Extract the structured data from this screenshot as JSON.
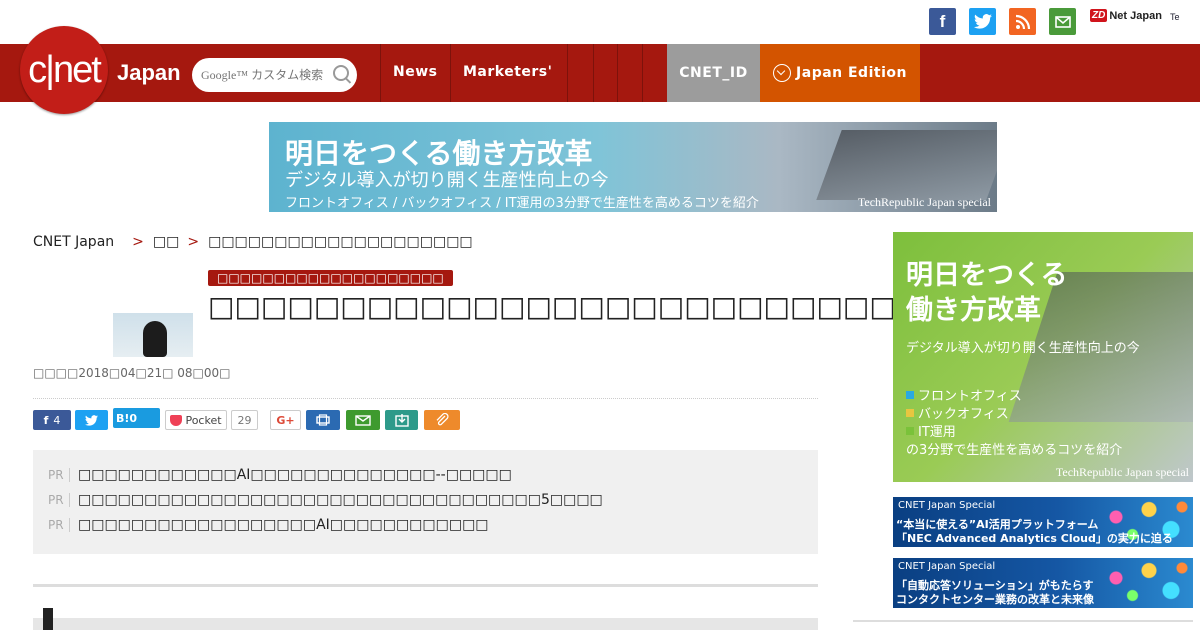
{
  "social": {
    "facebook": "f",
    "twitter": "t",
    "rss": "rss",
    "mail": "mail",
    "zdnet": "Net Japan",
    "zd": "ZD",
    "techrepublic": "Te"
  },
  "nav": {
    "logo": "c|net",
    "logo_japan": "Japan",
    "search_placeholder": "Google™ カスタム検索",
    "links": [
      "News",
      "Marketers'"
    ],
    "cnet_id": "CNET_ID",
    "edition": "Japan Edition"
  },
  "banner": {
    "title": "明日をつくる働き方改革",
    "subtitle": "デジタル導入が切り開く生産性向上の今",
    "line": "フロントオフィス / バックオフィス / IT運用の3分野で生産性を高めるコツを紹介",
    "brand": "TechRepublic Japan special"
  },
  "breadcrumb": {
    "home": "CNET Japan",
    "sep": ">",
    "section": "□□",
    "current": "□□□□□□□□□□□□□□□□□□□□"
  },
  "article": {
    "category": "□□□□□□□□□□□□□□□□□□□□",
    "title": "□□□□□□□□□□□□□□□□□□□□□□□□□□□□□□□□□",
    "date": "□□□□2018□04□21□ 08□00□"
  },
  "share": {
    "fb_count": "4",
    "hatena": "B!0",
    "pocket": "Pocket",
    "pocket_count": "29",
    "gplus": "G+"
  },
  "pr": {
    "tag": "PR",
    "items": [
      "□□□□□□□□□□□□AI□□□□□□□□□□□□□□--□□□□□",
      "□□□□□□□□□□□□□□□□□□□□□□□□□□□□□□□□□□□5□□□□",
      "□□□□□□□□□□□□□□□□□□AI□□□□□□□□□□□□"
    ]
  },
  "sidebar": {
    "ad1": {
      "title_l1": "明日をつくる",
      "title_l2": "働き方改革",
      "subtitle": "デジタル導入が切り開く生産性向上の今",
      "items": [
        "フロントオフィス",
        "バックオフィス",
        "IT運用"
      ],
      "item_colors": [
        "#2aa9e0",
        "#e8c640",
        "#7ac23a"
      ],
      "tail": "の3分野で生産性を高めるコツを紹介",
      "brand": "TechRepublic Japan special"
    },
    "ad2": {
      "label": "CNET Japan Special",
      "line1": "“本当に使える”AI活用プラットフォーム",
      "line2": "「NEC Advanced Analytics Cloud」の実力に迫る"
    },
    "ad3": {
      "label": "CNET Japan Special",
      "line1": "「自動応答ソリューション」がもたらす",
      "line2": "コンタクトセンター業務の改革と未来像"
    }
  }
}
